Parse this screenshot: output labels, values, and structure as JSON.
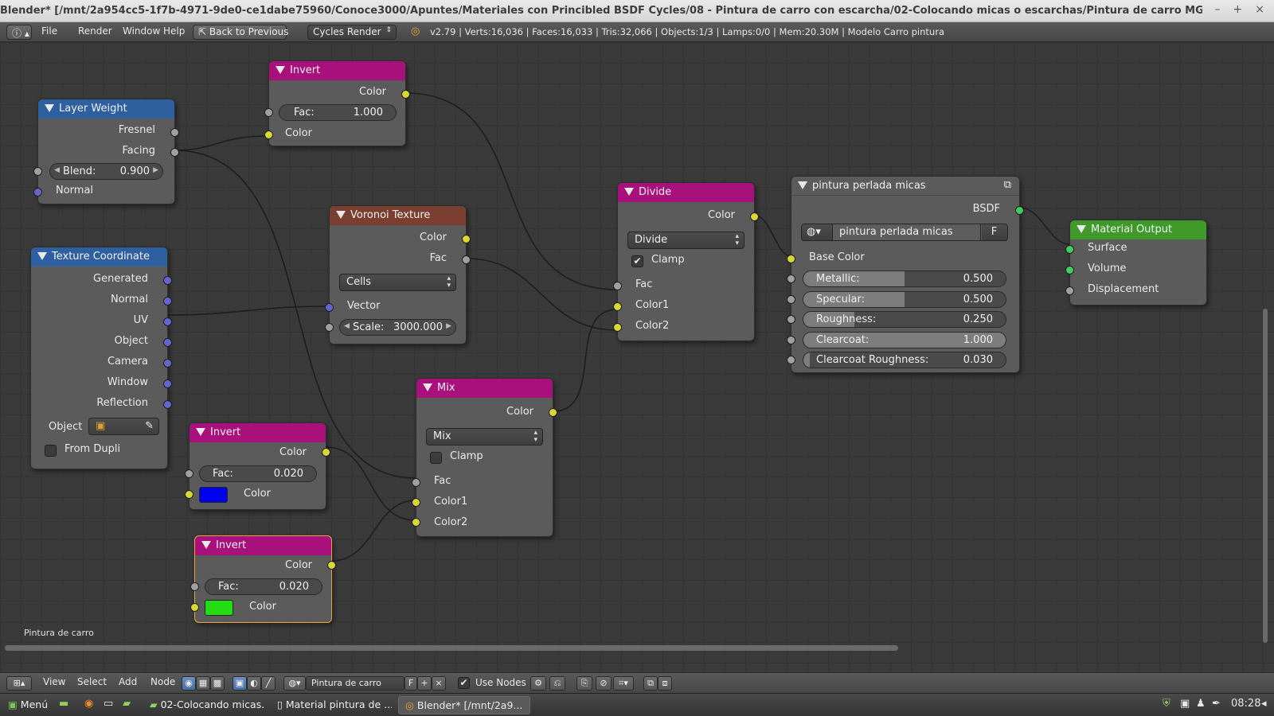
{
  "window": {
    "title": "Blender* [/mnt/2a954cc5-1f7b-4971-9de0-ce1dabe75960/Conoce3000/Apuntes/Materiales con Princibled BSDF Cycles/08 - Pintura de carro con escarcha/02-Colocando micas o escarchas/Pintura de carro MG.blend]",
    "controls": [
      "–",
      "+",
      "×"
    ]
  },
  "infobar": {
    "menus": [
      "File",
      "Render",
      "Window",
      "Help"
    ],
    "back_button": "Back to Previous",
    "render_engine": "Cycles Render",
    "stats": "v2.79 | Verts:16,036 | Faces:16,033 | Tris:32,066 | Objects:1/3 | Lamps:0/0 | Mem:20.30M | Modelo Carro pintura"
  },
  "nodes": {
    "invert_top": {
      "title": "Invert",
      "out_color": "Color",
      "fac_label": "Fac:",
      "fac_value": "1.000",
      "in_color": "Color"
    },
    "layer_weight": {
      "title": "Layer Weight",
      "fresnel": "Fresnel",
      "facing": "Facing",
      "blend_label": "Blend:",
      "blend_value": "0.900",
      "normal": "Normal"
    },
    "texture_coordinate": {
      "title": "Texture Coordinate",
      "outputs": [
        "Generated",
        "Normal",
        "UV",
        "Object",
        "Camera",
        "Window",
        "Reflection"
      ],
      "object_label": "Object",
      "from_dupli": "From Dupli"
    },
    "voronoi": {
      "title": "Voronoi Texture",
      "out_color": "Color",
      "out_fac": "Fac",
      "coloring": "Cells",
      "vector": "Vector",
      "scale_label": "Scale:",
      "scale_value": "3000.000"
    },
    "divide": {
      "title": "Divide",
      "out_color": "Color",
      "operation": "Divide",
      "clamp": "Clamp",
      "clamp_checked": true,
      "fac": "Fac",
      "color1": "Color1",
      "color2": "Color2"
    },
    "bsdf": {
      "title": "pintura perlada micas",
      "out": "BSDF",
      "material_name": "pintura perlada micas",
      "fake_user": "F",
      "base_color": "Base Color",
      "params": [
        {
          "label": "Metallic:",
          "value": "0.500",
          "fraction": 0.5
        },
        {
          "label": "Specular:",
          "value": "0.500",
          "fraction": 0.5
        },
        {
          "label": "Roughness:",
          "value": "0.250",
          "fraction": 0.25
        },
        {
          "label": "Clearcoat:",
          "value": "1.000",
          "fraction": 1.0
        },
        {
          "label": "Clearcoat Roughness:",
          "value": "0.030",
          "fraction": 0.03
        }
      ]
    },
    "material_output": {
      "title": "Material Output",
      "surface": "Surface",
      "volume": "Volume",
      "displacement": "Displacement"
    },
    "mix": {
      "title": "Mix",
      "out_color": "Color",
      "blend_type": "Mix",
      "clamp": "Clamp",
      "clamp_checked": false,
      "fac": "Fac",
      "color1": "Color1",
      "color2": "Color2"
    },
    "invert_blue": {
      "title": "Invert",
      "out_color": "Color",
      "fac_label": "Fac:",
      "fac_value": "0.020",
      "in_color": "Color",
      "swatch": "#0000ee"
    },
    "invert_green": {
      "title": "Invert",
      "out_color": "Color",
      "fac_label": "Fac:",
      "fac_value": "0.020",
      "in_color": "Color",
      "swatch": "#22dd11"
    }
  },
  "editor": {
    "material_label": "Pintura de carro"
  },
  "node_header": {
    "menus": [
      "View",
      "Select",
      "Add",
      "Node"
    ],
    "material_name": "Pintura de carro",
    "fake_user": "F",
    "use_nodes": "Use Nodes",
    "use_nodes_checked": true
  },
  "taskbar": {
    "menu": "Menú",
    "tasks": [
      "02-Colocando micas...",
      "Material pintura de ...",
      "Blender* [/mnt/2a9..."
    ],
    "clock": "08:28"
  },
  "colors": {
    "conv_header": "#a8107c",
    "input_header": "#2e5f9f",
    "texture_header": "#7a3f30",
    "output_header": "#3f9a2a",
    "socket_color": "#d8d835",
    "socket_vector": "#6565d0",
    "socket_shader": "#3fcf5f"
  }
}
